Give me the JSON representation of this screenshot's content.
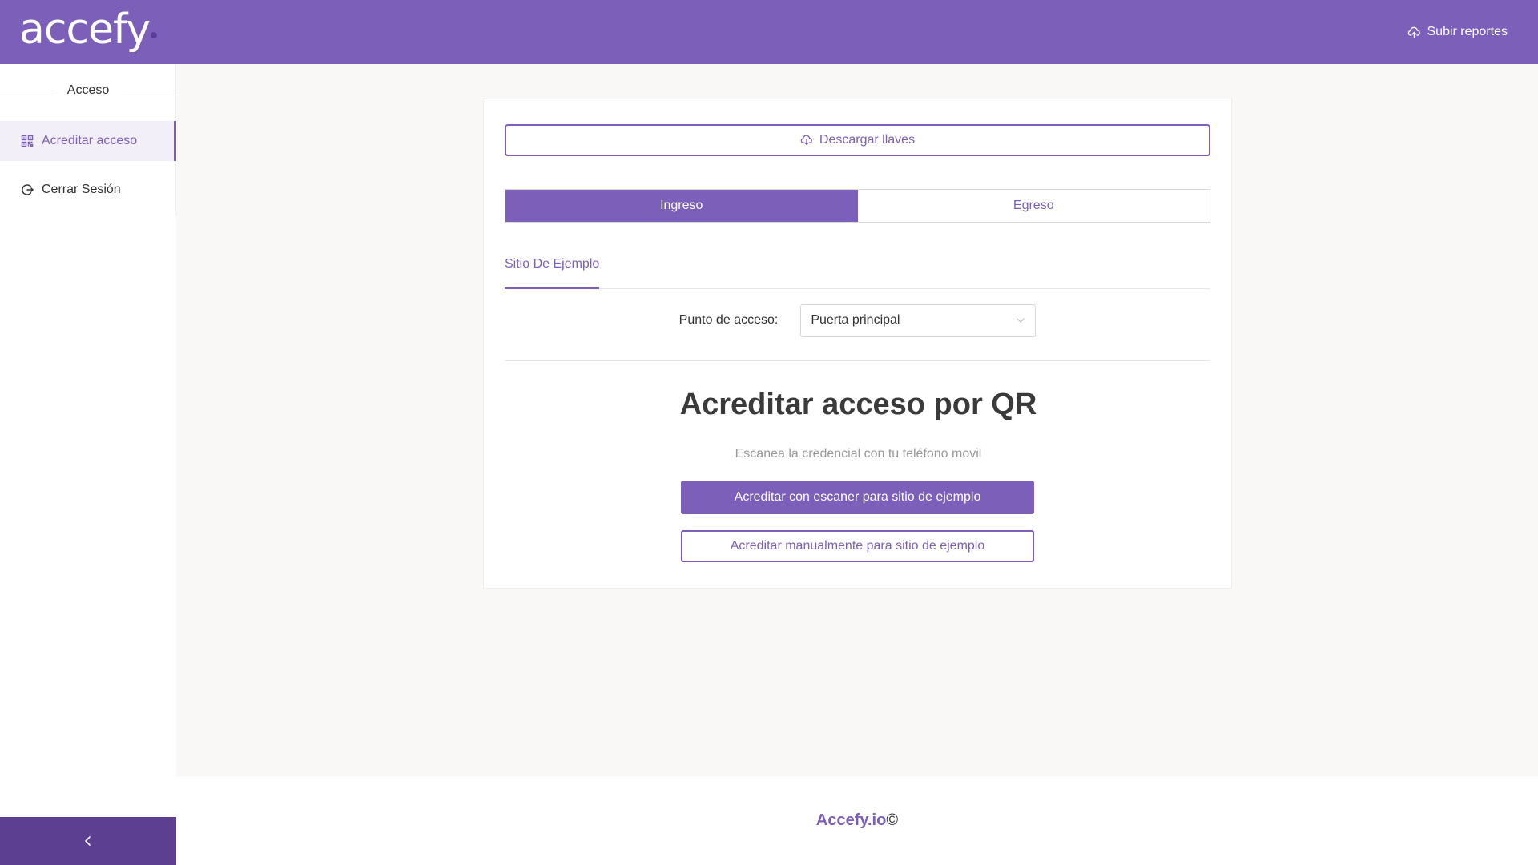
{
  "header": {
    "logo_text": "accefy",
    "upload_label": "Subir reportes",
    "colors": {
      "brand": "#7b5fb9",
      "brand_dark": "#5d3f91"
    }
  },
  "sidebar": {
    "section_title": "Acceso",
    "items": [
      {
        "label": "Acreditar acceso",
        "icon": "qrcode-icon",
        "active": true
      },
      {
        "label": "Cerrar Sesión",
        "icon": "logout-icon",
        "active": false
      }
    ],
    "collapse_icon": "chevron-left-icon"
  },
  "main": {
    "download_label": "Descargar llaves",
    "segment": {
      "ingreso": "Ingreso",
      "egreso": "Egreso",
      "selected": "Ingreso"
    },
    "tab_label": "Sitio De Ejemplo",
    "access_point": {
      "label": "Punto de acceso:",
      "value": "Puerta principal"
    },
    "qr_title": "Acreditar acceso por QR",
    "qr_subtitle": "Escanea la credencial con tu teléfono movil",
    "scan_button": "Acreditar con escaner para sitio de ejemplo",
    "manual_button": "Acreditar manualmente para sitio de ejemplo"
  },
  "footer": {
    "brand": "Accefy.io",
    "copyright": "©"
  }
}
